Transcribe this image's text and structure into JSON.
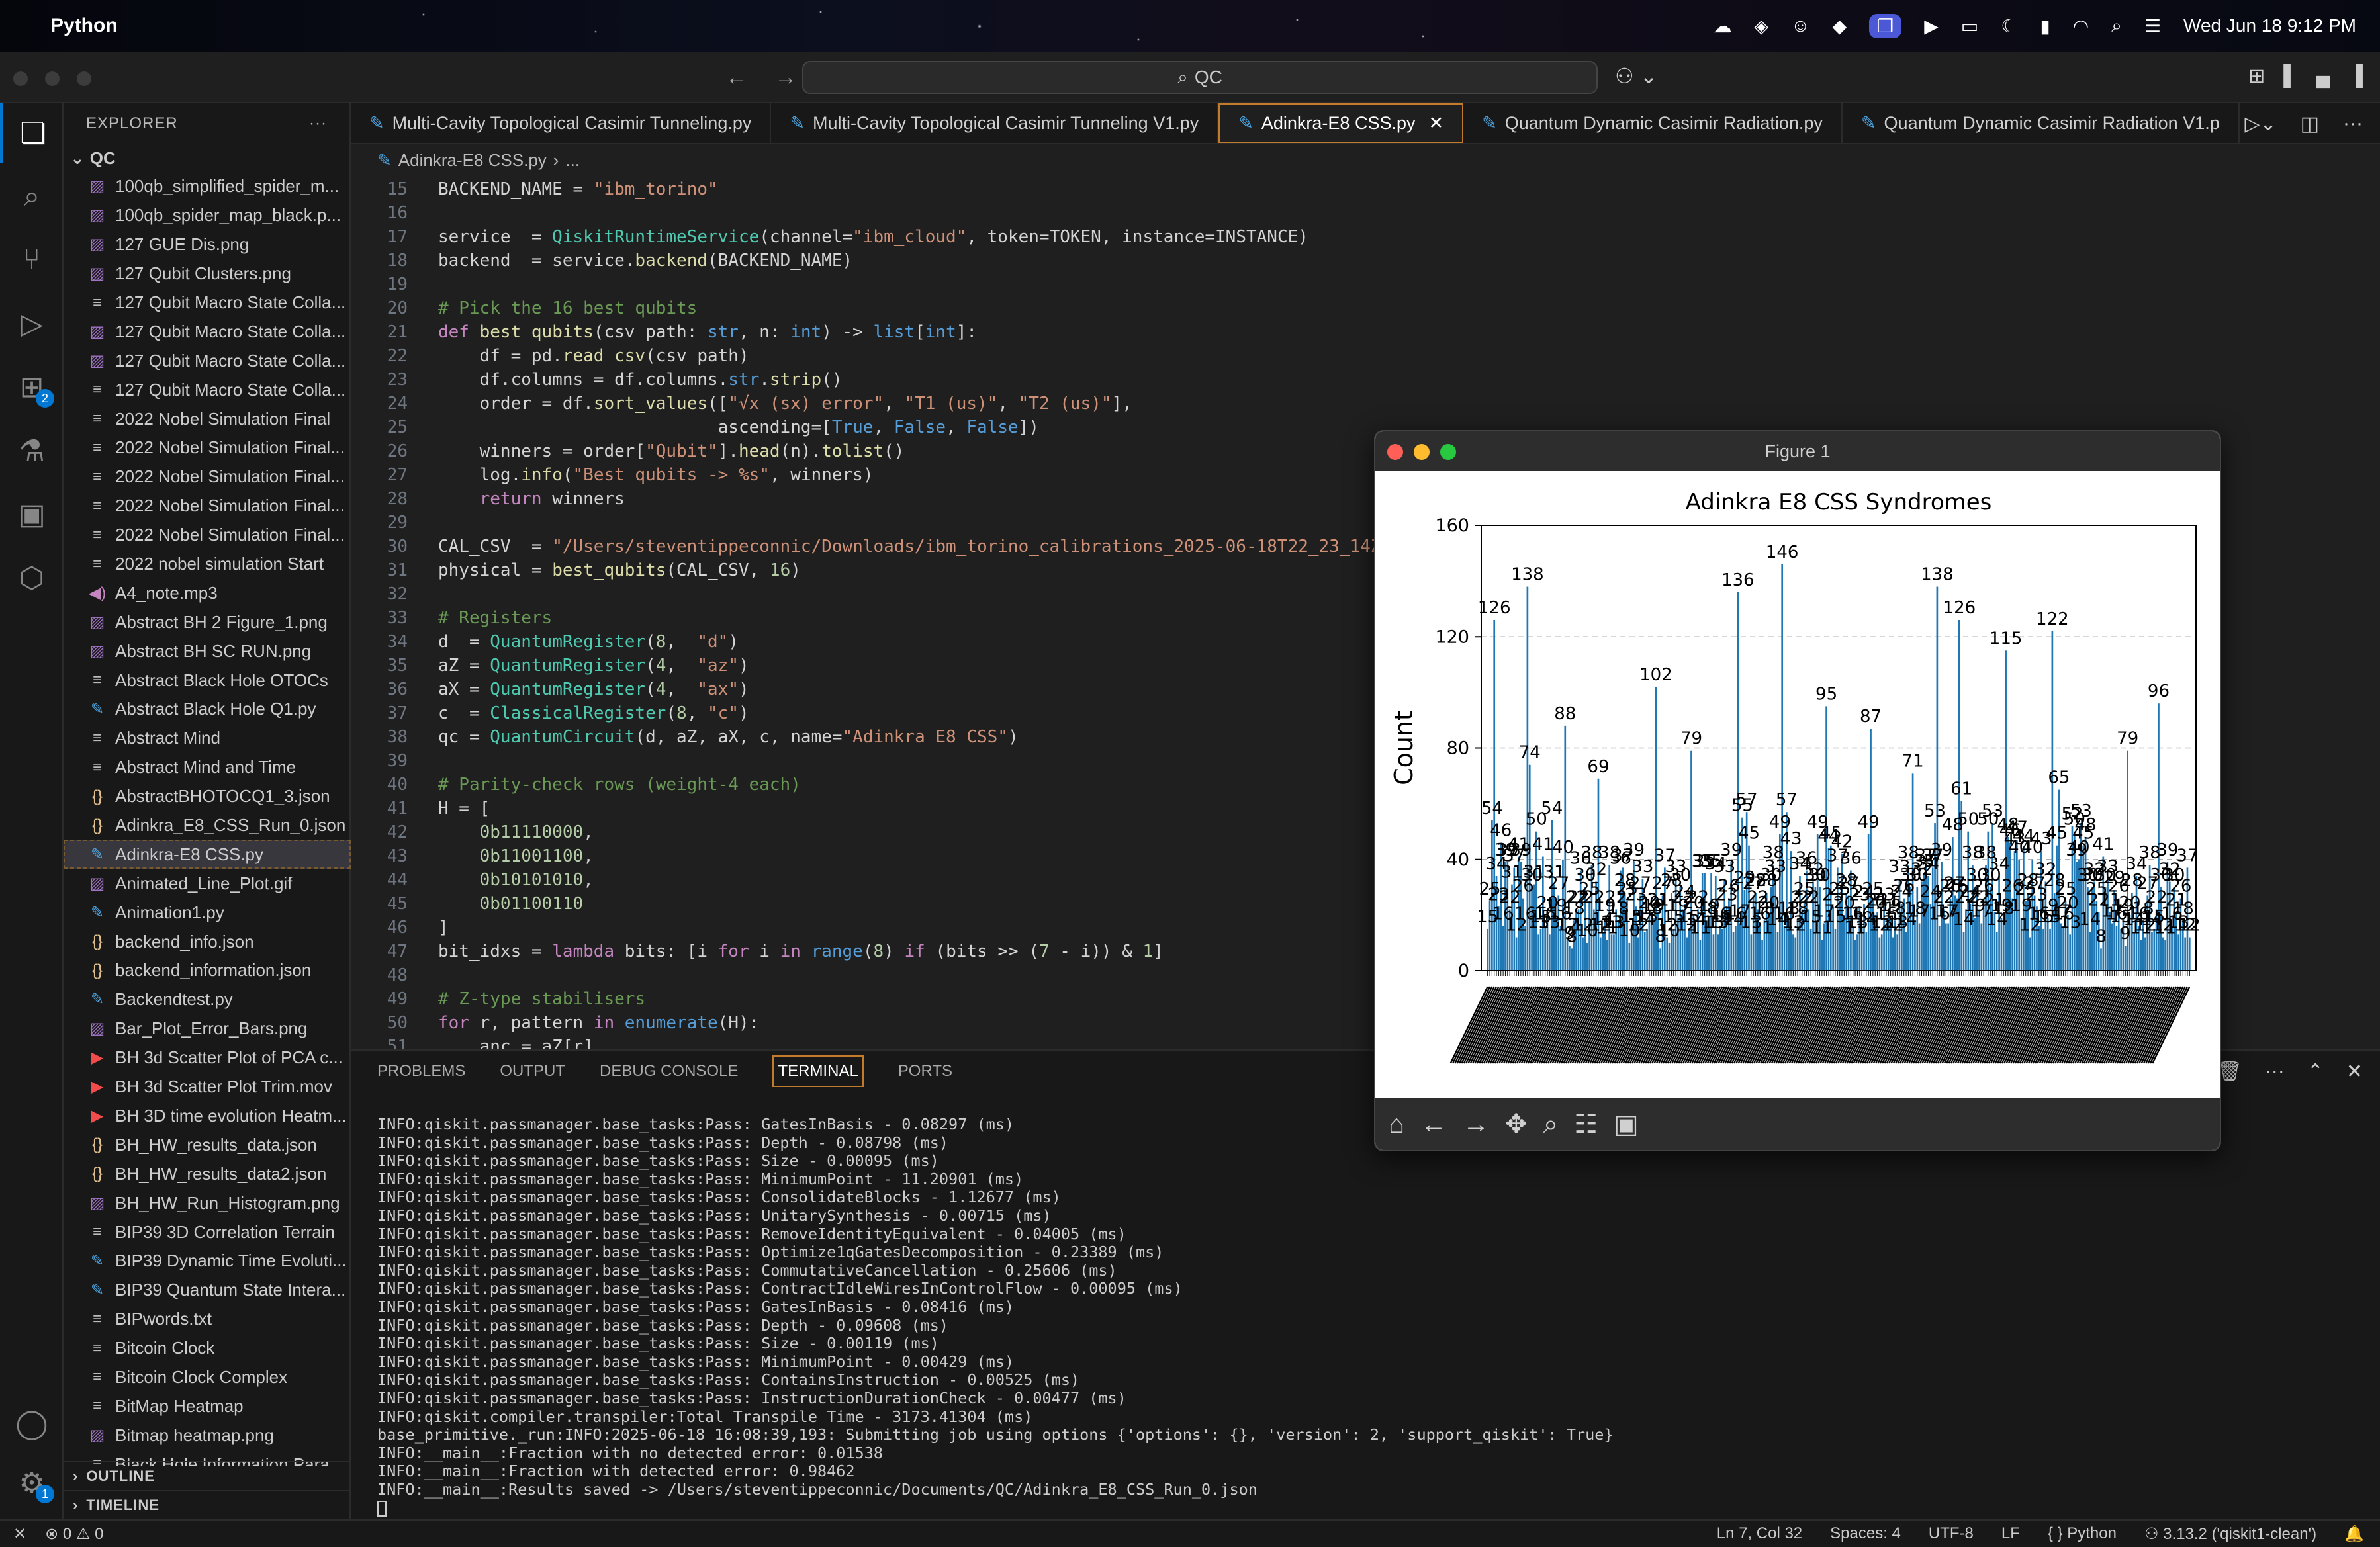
{
  "menubar": {
    "app": "Python",
    "datetime": "Wed Jun 18  9:12 PM"
  },
  "window": {
    "search": "QC"
  },
  "explorer": {
    "title": "EXPLORER",
    "root": "QC",
    "files": [
      {
        "name": "100qb_simplified_spider_m...",
        "type": "img"
      },
      {
        "name": "100qb_spider_map_black.p...",
        "type": "img"
      },
      {
        "name": "127 GUE Dis.png",
        "type": "img"
      },
      {
        "name": "127 Qubit Clusters.png",
        "type": "img"
      },
      {
        "name": "127 Qubit Macro State Colla...",
        "type": "txt"
      },
      {
        "name": "127 Qubit Macro State Colla...",
        "type": "img"
      },
      {
        "name": "127 Qubit Macro State Colla...",
        "type": "img"
      },
      {
        "name": "127 Qubit Macro State Colla...",
        "type": "txt"
      },
      {
        "name": "2022 Nobel Simulation Final",
        "type": "txt"
      },
      {
        "name": "2022 Nobel Simulation Final...",
        "type": "txt"
      },
      {
        "name": "2022 Nobel Simulation Final...",
        "type": "txt"
      },
      {
        "name": "2022 Nobel Simulation Final...",
        "type": "txt"
      },
      {
        "name": "2022 Nobel Simulation Final...",
        "type": "txt"
      },
      {
        "name": "2022 nobel simulation Start",
        "type": "txt"
      },
      {
        "name": "A4_note.mp3",
        "type": "mp3"
      },
      {
        "name": "Abstract BH 2 Figure_1.png",
        "type": "img"
      },
      {
        "name": "Abstract BH SC RUN.png",
        "type": "img"
      },
      {
        "name": "Abstract Black Hole OTOCs",
        "type": "txt"
      },
      {
        "name": "Abstract Black Hole Q1.py",
        "type": "py"
      },
      {
        "name": "Abstract Mind",
        "type": "txt"
      },
      {
        "name": "Abstract Mind and Time",
        "type": "txt"
      },
      {
        "name": "AbstractBHOTOCQ1_3.json",
        "type": "json"
      },
      {
        "name": "Adinkra_E8_CSS_Run_0.json",
        "type": "json"
      },
      {
        "name": "Adinkra-E8 CSS.py",
        "type": "py",
        "selected": true
      },
      {
        "name": "Animated_Line_Plot.gif",
        "type": "gif"
      },
      {
        "name": "Animation1.py",
        "type": "py"
      },
      {
        "name": "backend_info.json",
        "type": "json"
      },
      {
        "name": "backend_information.json",
        "type": "json"
      },
      {
        "name": "Backendtest.py",
        "type": "py"
      },
      {
        "name": "Bar_Plot_Error_Bars.png",
        "type": "img"
      },
      {
        "name": "BH 3d Scatter Plot of PCA c...",
        "type": "mov"
      },
      {
        "name": "BH 3d Scatter Plot Trim.mov",
        "type": "mov"
      },
      {
        "name": "BH 3D time evolution Heatm...",
        "type": "mov"
      },
      {
        "name": "BH_HW_results_data.json",
        "type": "json"
      },
      {
        "name": "BH_HW_results_data2.json",
        "type": "json"
      },
      {
        "name": "BH_HW_Run_Histogram.png",
        "type": "img"
      },
      {
        "name": "BIP39 3D Correlation Terrain",
        "type": "txt"
      },
      {
        "name": "BIP39 Dynamic Time Evoluti...",
        "type": "py"
      },
      {
        "name": "BIP39 Quantum State Intera...",
        "type": "py"
      },
      {
        "name": "BIPwords.txt",
        "type": "txt"
      },
      {
        "name": "Bitcoin Clock",
        "type": "txt"
      },
      {
        "name": "Bitcoin Clock Complex",
        "type": "txt"
      },
      {
        "name": "BitMap Heatmap",
        "type": "txt"
      },
      {
        "name": "Bitmap heatmap.png",
        "type": "img"
      },
      {
        "name": "Black Hole Information Para...",
        "type": "txt"
      }
    ],
    "outline": "OUTLINE",
    "timeline": "TIMELINE"
  },
  "tabs": [
    {
      "label": "Multi-Cavity Topological Casimir Tunneling.py",
      "active": false
    },
    {
      "label": "Multi-Cavity Topological Casimir Tunneling V1.py",
      "active": false
    },
    {
      "label": "Adinkra-E8 CSS.py",
      "active": true
    },
    {
      "label": "Quantum Dynamic Casimir Radiation.py",
      "active": false
    },
    {
      "label": "Quantum Dynamic Casimir Radiation V1.p",
      "active": false
    }
  ],
  "breadcrumb": {
    "file": "Adinkra-E8 CSS.py",
    "rest": "..."
  },
  "code_lines": [
    {
      "n": "15",
      "t": "BACKEND_NAME = \"ibm_torino\""
    },
    {
      "n": "16",
      "t": ""
    },
    {
      "n": "17",
      "t": "service  = QiskitRuntimeService(channel=\"ibm_cloud\", token=TOKEN, instance=INSTANCE)"
    },
    {
      "n": "18",
      "t": "backend  = service.backend(BACKEND_NAME)"
    },
    {
      "n": "19",
      "t": ""
    },
    {
      "n": "20",
      "t": "# Pick the 16 best qubits"
    },
    {
      "n": "21",
      "t": "def best_qubits(csv_path: str, n: int) -> list[int]:"
    },
    {
      "n": "22",
      "t": "    df = pd.read_csv(csv_path)"
    },
    {
      "n": "23",
      "t": "    df.columns = df.columns.str.strip()"
    },
    {
      "n": "24",
      "t": "    order = df.sort_values([\"√x (sx) error\", \"T1 (us)\", \"T2 (us)\"],"
    },
    {
      "n": "25",
      "t": "                           ascending=[True, False, False])"
    },
    {
      "n": "26",
      "t": "    winners = order[\"Qubit\"].head(n).tolist()"
    },
    {
      "n": "27",
      "t": "    log.info(\"Best qubits -> %s\", winners)"
    },
    {
      "n": "28",
      "t": "    return winners"
    },
    {
      "n": "29",
      "t": ""
    },
    {
      "n": "30",
      "t": "CAL_CSV  = \"/Users/steventippeconnic/Downloads/ibm_torino_calibrations_2025-06-18T22_23_14Z.csv\""
    },
    {
      "n": "31",
      "t": "physical = best_qubits(CAL_CSV, 16)"
    },
    {
      "n": "32",
      "t": ""
    },
    {
      "n": "33",
      "t": "# Registers"
    },
    {
      "n": "34",
      "t": "d  = QuantumRegister(8,  \"d\")"
    },
    {
      "n": "35",
      "t": "aZ = QuantumRegister(4,  \"az\")"
    },
    {
      "n": "36",
      "t": "aX = QuantumRegister(4,  \"ax\")"
    },
    {
      "n": "37",
      "t": "c  = ClassicalRegister(8, \"c\")"
    },
    {
      "n": "38",
      "t": "qc = QuantumCircuit(d, aZ, aX, c, name=\"Adinkra_E8_CSS\")"
    },
    {
      "n": "39",
      "t": ""
    },
    {
      "n": "40",
      "t": "# Parity-check rows (weight-4 each)"
    },
    {
      "n": "41",
      "t": "H = ["
    },
    {
      "n": "42",
      "t": "    0b11110000,"
    },
    {
      "n": "43",
      "t": "    0b11001100,"
    },
    {
      "n": "44",
      "t": "    0b10101010,"
    },
    {
      "n": "45",
      "t": "    0b01100110"
    },
    {
      "n": "46",
      "t": "]"
    },
    {
      "n": "47",
      "t": "bit_idxs = lambda bits: [i for i in range(8) if (bits >> (7 - i)) & 1]"
    },
    {
      "n": "48",
      "t": ""
    },
    {
      "n": "49",
      "t": "# Z-type stabilisers"
    },
    {
      "n": "50",
      "t": "for r, pattern in enumerate(H):"
    },
    {
      "n": "51",
      "t": "    anc = aZ[r]"
    }
  ],
  "panel": {
    "tabs": [
      "PROBLEMS",
      "OUTPUT",
      "DEBUG CONSOLE",
      "TERMINAL",
      "PORTS"
    ],
    "active_tab": "TERMINAL",
    "terminal": [
      "INFO:qiskit.passmanager.base_tasks:Pass: GatesInBasis - 0.08297 (ms)",
      "INFO:qiskit.passmanager.base_tasks:Pass: Depth - 0.08798 (ms)",
      "INFO:qiskit.passmanager.base_tasks:Pass: Size - 0.00095 (ms)",
      "INFO:qiskit.passmanager.base_tasks:Pass: MinimumPoint - 11.20901 (ms)",
      "INFO:qiskit.passmanager.base_tasks:Pass: ConsolidateBlocks - 1.12677 (ms)",
      "INFO:qiskit.passmanager.base_tasks:Pass: UnitarySynthesis - 0.00715 (ms)",
      "INFO:qiskit.passmanager.base_tasks:Pass: RemoveIdentityEquivalent - 0.04005 (ms)",
      "INFO:qiskit.passmanager.base_tasks:Pass: Optimize1qGatesDecomposition - 0.23389 (ms)",
      "INFO:qiskit.passmanager.base_tasks:Pass: CommutativeCancellation - 0.25606 (ms)",
      "INFO:qiskit.passmanager.base_tasks:Pass: ContractIdleWiresInControlFlow - 0.00095 (ms)",
      "INFO:qiskit.passmanager.base_tasks:Pass: GatesInBasis - 0.08416 (ms)",
      "INFO:qiskit.passmanager.base_tasks:Pass: Depth - 0.09608 (ms)",
      "INFO:qiskit.passmanager.base_tasks:Pass: Size - 0.00119 (ms)",
      "INFO:qiskit.passmanager.base_tasks:Pass: MinimumPoint - 0.00429 (ms)",
      "INFO:qiskit.passmanager.base_tasks:Pass: ContainsInstruction - 0.00525 (ms)",
      "INFO:qiskit.passmanager.base_tasks:Pass: InstructionDurationCheck - 0.00477 (ms)",
      "INFO:qiskit.compiler.transpiler:Total Transpile Time - 3173.41304 (ms)",
      "base_primitive._run:INFO:2025-06-18 16:08:39,193: Submitting job using options {'options': {}, 'version': 2, 'support_qiskit': True}",
      "INFO:__main__:Fraction with no detected error: 0.01538",
      "INFO:__main__:Fraction with detected error: 0.98462",
      "INFO:__main__:Results saved -> /Users/steventippeconnic/Documents/QC/Adinkra_E8_CSS_Run_0.json"
    ]
  },
  "statusbar": {
    "errors": "0",
    "warnings": "0",
    "position": "Ln 7, Col 32",
    "spaces": "Spaces: 4",
    "encoding": "UTF-8",
    "eol": "LF",
    "language": "{ } Python",
    "interpreter": "3.13.2 ('qiskit1-clean')"
  },
  "figure": {
    "window_title": "Figure 1",
    "chart_data": {
      "type": "bar",
      "title": "Adinkra E8 CSS Syndromes",
      "xlabel": "",
      "ylabel": "Count",
      "ylim": [
        0,
        160
      ],
      "yticks": [
        0,
        40,
        80,
        120,
        160
      ],
      "grid": "y-dashed",
      "color": "#1f77b4",
      "values": [
        15,
        25,
        54,
        126,
        34,
        23,
        46,
        16,
        39,
        39,
        22,
        31,
        37,
        12,
        41,
        39,
        26,
        16,
        138,
        74,
        30,
        31,
        50,
        13,
        15,
        41,
        16,
        20,
        13,
        54,
        31,
        19,
        27,
        16,
        40,
        88,
        12,
        9,
        8,
        18,
        22,
        22,
        36,
        12,
        30,
        10,
        25,
        38,
        22,
        32,
        69,
        12,
        14,
        19,
        11,
        38,
        13,
        13,
        22,
        18,
        36,
        37,
        28,
        25,
        10,
        15,
        39,
        23,
        12,
        27,
        33,
        14,
        15,
        20,
        18,
        19,
        102,
        21,
        8,
        27,
        37,
        12,
        10,
        28,
        15,
        33,
        19,
        30,
        22,
        24,
        12,
        15,
        79,
        20,
        14,
        22,
        11,
        35,
        35,
        18,
        19,
        35,
        13,
        34,
        13,
        16,
        15,
        33,
        23,
        26,
        39,
        14,
        16,
        136,
        17,
        55,
        29,
        57,
        45,
        13,
        27,
        28,
        22,
        16,
        11,
        18,
        28,
        20,
        30,
        38,
        33,
        14,
        49,
        146,
        16,
        57,
        18,
        43,
        13,
        12,
        18,
        34,
        22,
        25,
        36,
        22,
        15,
        32,
        30,
        49,
        30,
        11,
        17,
        95,
        44,
        45,
        23,
        15,
        37,
        25,
        42,
        20,
        28,
        27,
        36,
        16,
        11,
        13,
        23,
        16,
        24,
        14,
        49,
        87,
        25,
        20,
        21,
        12,
        13,
        23,
        16,
        21,
        19,
        12,
        18,
        13,
        33,
        24,
        26,
        14,
        38,
        30,
        71,
        18,
        30,
        17,
        32,
        35,
        37,
        34,
        24,
        37,
        53,
        138,
        16,
        39,
        22,
        17,
        17,
        26,
        48,
        27,
        26,
        126,
        61,
        14,
        22,
        50,
        24,
        38,
        19,
        30,
        22,
        17,
        26,
        38,
        50,
        30,
        53,
        21,
        14,
        34,
        19,
        18,
        115,
        48,
        46,
        26,
        43,
        47,
        40,
        19,
        44,
        25,
        28,
        12,
        40,
        27,
        23,
        16,
        43,
        15,
        32,
        19,
        15,
        122,
        28,
        45,
        65,
        17,
        16,
        25,
        20,
        13,
        52,
        50,
        39,
        40,
        53,
        45,
        48,
        30,
        14,
        30,
        32,
        25,
        21,
        8,
        41,
        30,
        33,
        21,
        17,
        29,
        16,
        26,
        15,
        19,
        9,
        79,
        20,
        28,
        14,
        34,
        16,
        11,
        18,
        12,
        27,
        38,
        14,
        15,
        22,
        96,
        30,
        12,
        11,
        39,
        32,
        16,
        30,
        21,
        13,
        26,
        18,
        12,
        37,
        12
      ]
    }
  }
}
